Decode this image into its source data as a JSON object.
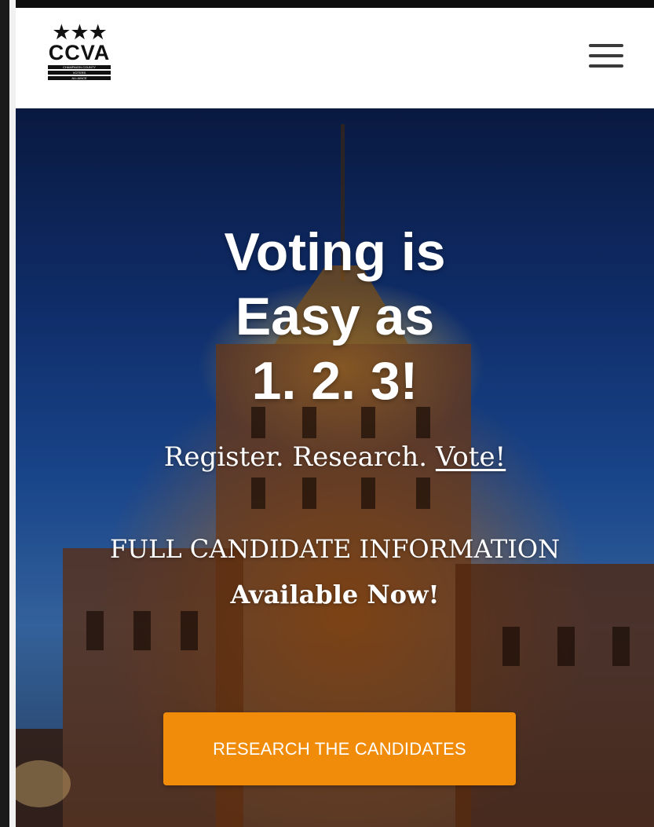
{
  "header": {
    "logo": {
      "stars": "★★★",
      "wordmark": "CCVA",
      "tagline_lines": [
        "CHAMPAIGN COUNTY",
        "VOTERS",
        "ALLIANCE"
      ]
    },
    "menu_icon": "hamburger-menu-icon"
  },
  "hero": {
    "headline_line1": "Voting is",
    "headline_line2": "Easy as",
    "headline_line3": "1. 2. 3!",
    "tagline_part1": "Register.",
    "tagline_part2": "Research.",
    "tagline_link": "Vote!",
    "info_line": "FULL CANDIDATE INFORMATION",
    "available": "Available Now!",
    "cta_label": "RESEARCH THE CANDIDATES"
  },
  "colors": {
    "cta_background": "#f08c0a",
    "header_background": "#ffffff",
    "text": "#ffffff"
  }
}
